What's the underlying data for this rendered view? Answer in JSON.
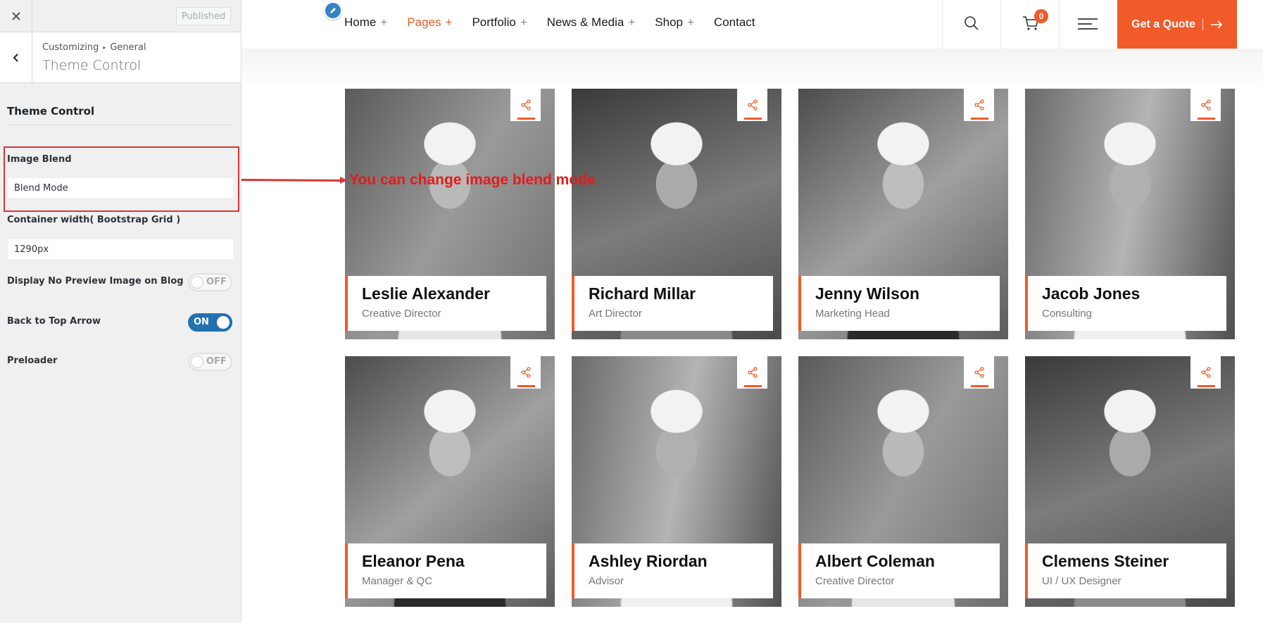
{
  "customizer": {
    "published_label": "Published",
    "breadcrumb_root": "Customizing",
    "breadcrumb_parent": "General",
    "panel_title": "Theme Control",
    "section_title": "Theme Control",
    "image_blend": {
      "label": "Image Blend",
      "value": "Blend Mode"
    },
    "container_width": {
      "label": "Container width( Bootstrap Grid )",
      "value": "1290px"
    },
    "toggles": [
      {
        "label": "Display No Preview Image on Blog",
        "state": "OFF"
      },
      {
        "label": "Back to Top Arrow",
        "state": "ON"
      },
      {
        "label": "Preloader",
        "state": "OFF"
      }
    ]
  },
  "annotation": {
    "text": "You can change image blend mode",
    "color": "#e41b1b"
  },
  "header": {
    "nav": [
      {
        "label": "Home",
        "plus": "+"
      },
      {
        "label": "Pages",
        "plus": "+",
        "active": true
      },
      {
        "label": "Portfolio",
        "plus": "+"
      },
      {
        "label": "News & Media",
        "plus": "+"
      },
      {
        "label": "Shop",
        "plus": "+"
      },
      {
        "label": "Contact",
        "plus": ""
      }
    ],
    "cart_count": "0",
    "quote_label": "Get a Quote",
    "accent": "#f15a29"
  },
  "team": [
    {
      "name": "Leslie Alexander",
      "role": "Creative Director"
    },
    {
      "name": "Richard Millar",
      "role": "Art Director"
    },
    {
      "name": "Jenny Wilson",
      "role": "Marketing Head"
    },
    {
      "name": "Jacob Jones",
      "role": "Consulting"
    },
    {
      "name": "Eleanor Pena",
      "role": "Manager & QC"
    },
    {
      "name": "Ashley Riordan",
      "role": "Advisor"
    },
    {
      "name": "Albert Coleman",
      "role": "Creative Director"
    },
    {
      "name": "Clemens Steiner",
      "role": "UI / UX Designer"
    }
  ]
}
